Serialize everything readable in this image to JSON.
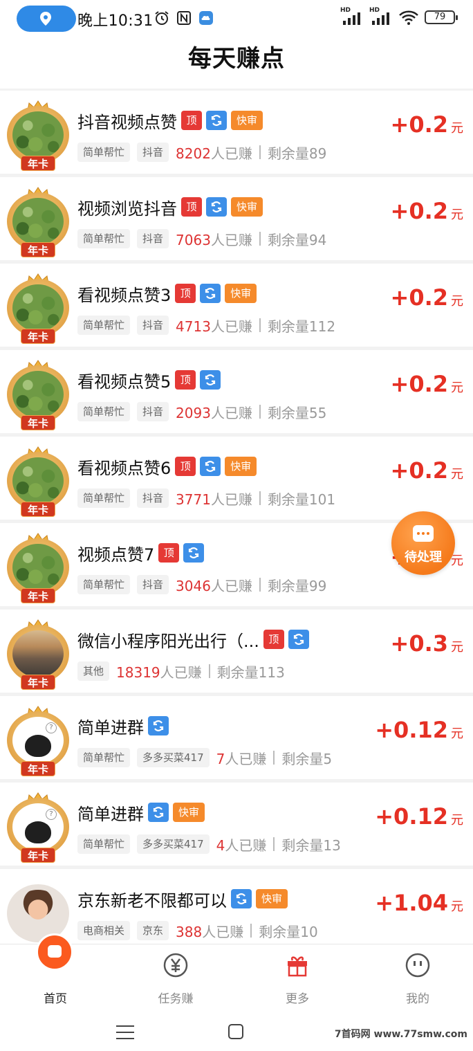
{
  "status_bar": {
    "time": "晚上10:31",
    "battery": "79"
  },
  "header": {
    "title": "每天赚点"
  },
  "tasks": [
    {
      "title": "抖音视频点赞",
      "avatar": "plant",
      "badge": "年卡",
      "tags": [
        "顶",
        "refresh",
        "快审"
      ],
      "chips": [
        "简单帮忙",
        "抖音"
      ],
      "earned_count": "8202",
      "earned_suffix": "人已赚",
      "remain": "剩余量89",
      "reward": "+0.2",
      "unit": "元"
    },
    {
      "title": "视频浏览抖音",
      "avatar": "plant",
      "badge": "年卡",
      "tags": [
        "顶",
        "refresh",
        "快审"
      ],
      "chips": [
        "简单帮忙",
        "抖音"
      ],
      "earned_count": "7063",
      "earned_suffix": "人已赚",
      "remain": "剩余量94",
      "reward": "+0.2",
      "unit": "元"
    },
    {
      "title": "看视频点赞3",
      "avatar": "plant",
      "badge": "年卡",
      "tags": [
        "顶",
        "refresh",
        "快审"
      ],
      "chips": [
        "简单帮忙",
        "抖音"
      ],
      "earned_count": "4713",
      "earned_suffix": "人已赚",
      "remain": "剩余量112",
      "reward": "+0.2",
      "unit": "元"
    },
    {
      "title": "看视频点赞5",
      "avatar": "plant",
      "badge": "年卡",
      "tags": [
        "顶",
        "refresh"
      ],
      "chips": [
        "简单帮忙",
        "抖音"
      ],
      "earned_count": "2093",
      "earned_suffix": "人已赚",
      "remain": "剩余量55",
      "reward": "+0.2",
      "unit": "元"
    },
    {
      "title": "看视频点赞6",
      "avatar": "plant",
      "badge": "年卡",
      "tags": [
        "顶",
        "refresh",
        "快审"
      ],
      "chips": [
        "简单帮忙",
        "抖音"
      ],
      "earned_count": "3771",
      "earned_suffix": "人已赚",
      "remain": "剩余量101",
      "reward": "+0.2",
      "unit": "元"
    },
    {
      "title": "视频点赞7",
      "avatar": "plant",
      "badge": "年卡",
      "tags": [
        "顶",
        "refresh"
      ],
      "chips": [
        "简单帮忙",
        "抖音"
      ],
      "earned_count": "3046",
      "earned_suffix": "人已赚",
      "remain": "剩余量99",
      "reward": "+0.2",
      "unit": "元"
    },
    {
      "title": "微信小程序阳光出行（...",
      "avatar": "rock",
      "badge": "年卡",
      "tags": [
        "顶",
        "refresh"
      ],
      "chips": [
        "其他"
      ],
      "earned_count": "18319",
      "earned_suffix": "人已赚",
      "remain": "剩余量113",
      "reward": "+0.3",
      "unit": "元"
    },
    {
      "title": "简单进群",
      "avatar": "cat",
      "badge": "年卡",
      "tags": [
        "refresh"
      ],
      "chips": [
        "简单帮忙",
        "多多买菜417"
      ],
      "earned_count": "7",
      "earned_suffix": "人已赚",
      "remain": "剩余量5",
      "reward": "+0.12",
      "unit": "元"
    },
    {
      "title": "简单进群",
      "avatar": "cat",
      "badge": "年卡",
      "tags": [
        "refresh",
        "快审"
      ],
      "chips": [
        "简单帮忙",
        "多多买菜417"
      ],
      "earned_count": "4",
      "earned_suffix": "人已赚",
      "remain": "剩余量13",
      "reward": "+0.12",
      "unit": "元"
    },
    {
      "title": "京东新老不限都可以",
      "avatar": "boy",
      "badge": "",
      "tags": [
        "refresh",
        "快审"
      ],
      "chips": [
        "电商相关",
        "京东"
      ],
      "earned_count": "388",
      "earned_suffix": "人已赚",
      "remain": "剩余量10",
      "reward": "+1.04",
      "unit": "元"
    }
  ],
  "floating": {
    "label": "待处理"
  },
  "tabbar": {
    "items": [
      {
        "label": "首页",
        "icon": "home-icon"
      },
      {
        "label": "任务赚",
        "icon": "yuan-icon"
      },
      {
        "label": "更多",
        "icon": "gift-icon"
      },
      {
        "label": "我的",
        "icon": "smile-icon"
      }
    ]
  },
  "watermark": "7首码网 www.77smw.com"
}
